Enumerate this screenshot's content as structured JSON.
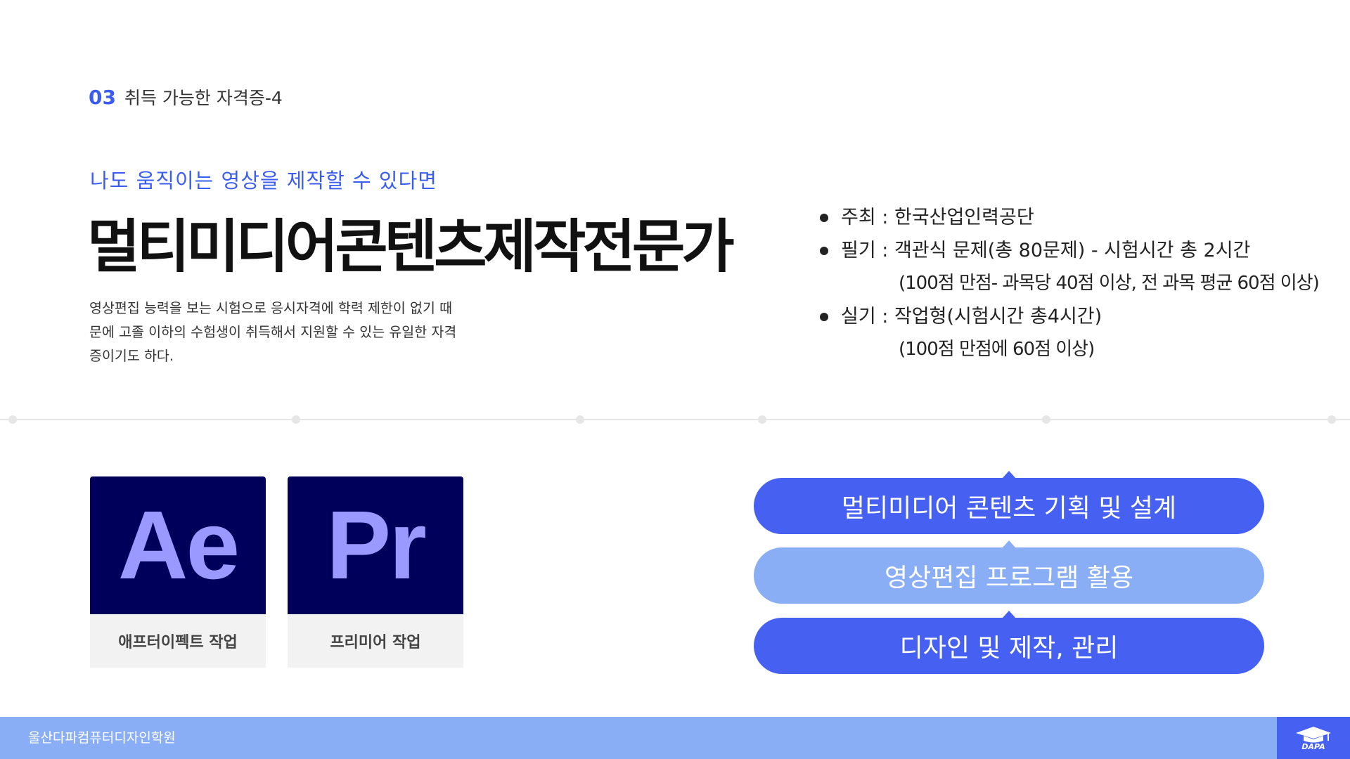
{
  "section": {
    "number": "03",
    "title": "취득 가능한 자격증-4"
  },
  "hero": {
    "subtitle": "나도 움직이는 영상을 제작할 수 있다면",
    "title": "멀티미디어콘텐츠제작전문가",
    "description": "영상편집 능력을 보는 시험으로 응시자격에 학력 제한이 없기 때문에 고졸 이하의 수험생이 취득해서 지원할 수 있는 유일한 자격증이기도 하다."
  },
  "info": {
    "host": "주최 : 한국산업인력공단",
    "written": "필기 : 객관식 문제(총 80문제) - 시험시간 총 2시간",
    "written_detail": "(100점 만점- 과목당 40점 이상, 전 과목 평균 60점 이상)",
    "practical": "실기 : 작업형(시험시간 총4시간)",
    "practical_detail": "(100점 만점에 60점 이상)"
  },
  "apps": [
    {
      "abbr": "Ae",
      "label": "애프터이펙트 작업",
      "icon": "after-effects-icon"
    },
    {
      "abbr": "Pr",
      "label": "프리미어 작업",
      "icon": "premiere-icon"
    }
  ],
  "skills": [
    {
      "label": "멀티미디어 콘텐츠 기획 및 설계",
      "color": "#4660f2"
    },
    {
      "label": "영상편집 프로그램 활용",
      "color": "#8aaef5"
    },
    {
      "label": "디자인 및 제작, 관리",
      "color": "#4660f2"
    }
  ],
  "footer": {
    "name": "울산다파컴퓨터디자인학원",
    "logo_text": "DAPA"
  },
  "colors": {
    "accent": "#3b5cf0",
    "app_bg": "#00005b",
    "app_fg": "#9999ff",
    "footer": "#8aaef5"
  }
}
